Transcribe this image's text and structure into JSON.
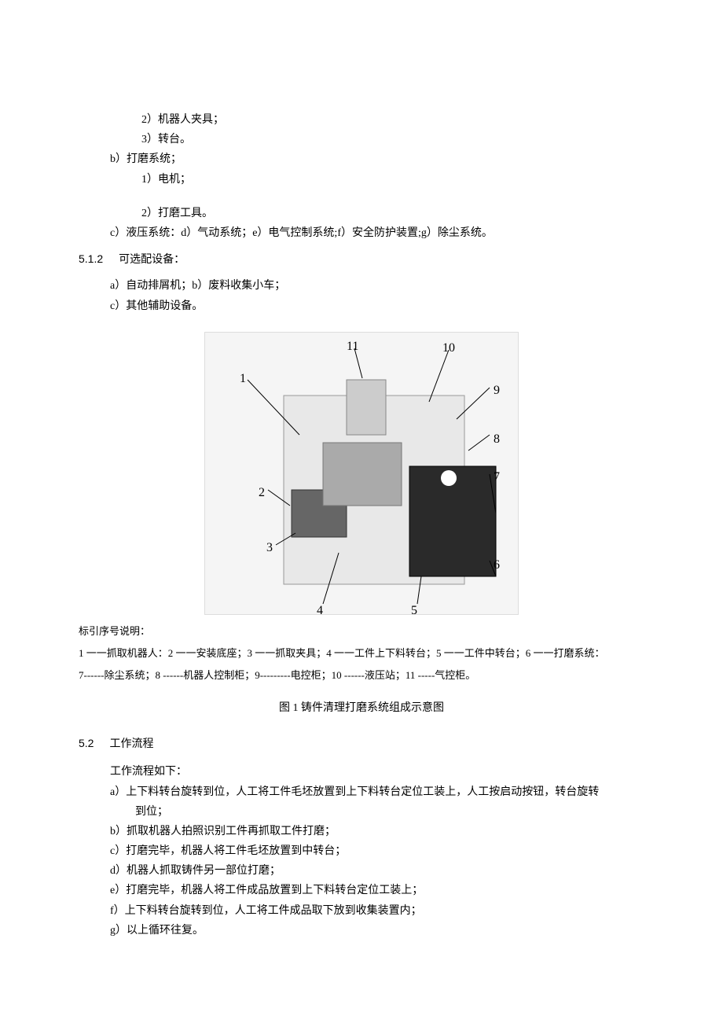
{
  "items": {
    "l2": "2）机器人夹具；",
    "l3": "3）转台。",
    "b": "b）打磨系统；",
    "b1": "1）电机；",
    "b2": "2）打磨工具。",
    "c": "c）液压系统：d）气动系统；e）电气控制系统;f）安全防护装置;g）除尘系统。"
  },
  "sec512": {
    "num": "5.1.2",
    "title": "可选配设备：",
    "a": "a）自动排屑机；b）废料收集小车；",
    "c": "c）其他辅助设备。"
  },
  "figure": {
    "labels": {
      "n1": "1",
      "n2": "2",
      "n3": "3",
      "n4": "4",
      "n5": "5",
      "n6": "6",
      "n7": "7",
      "n8": "8",
      "n9": "9",
      "n10": "10",
      "n11": "11"
    },
    "legend_title": "标引序号说明：",
    "legend_line1": "1 一一抓取机器人：2 一一安装底座；3 一一抓取夹具；4 一一工件上下料转台；5 一一工件中转台；6 一一打磨系统：",
    "legend_line2": "7------除尘系统；8 ------机器人控制柜；9---------电控柜；10 ------液压站；11 -----气控柜。",
    "caption": "图 1 铸件清理打磨系统组成示意图"
  },
  "sec52": {
    "num": "5.2",
    "title": "工作流程",
    "intro": "工作流程如下：",
    "a": "a）上下料转台旋转到位，人工将工件毛坯放置到上下料转台定位工装上，人工按启动按钮，转台旋转",
    "a_cont": "到位；",
    "b": "b）抓取机器人拍照识别工件再抓取工件打磨；",
    "c": "c）打磨完毕，机器人将工件毛坯放置到中转台；",
    "d": "d）机器人抓取铸件另一部位打磨；",
    "e": "e）打磨完毕，机器人将工件成品放置到上下料转台定位工装上；",
    "f": "f）上下料转台旋转到位，人工将工件成品取下放到收集装置内；",
    "g": "g）以上循环往复。"
  }
}
